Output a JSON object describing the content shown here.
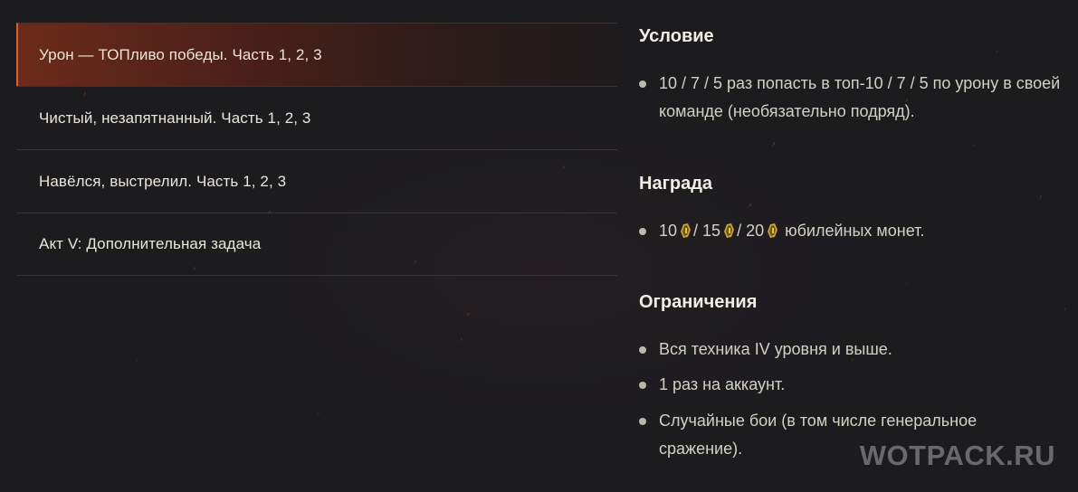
{
  "tabs": [
    {
      "label": "Урон — ТОПливо победы. Часть 1, 2, 3",
      "active": true
    },
    {
      "label": "Чистый, незапятнанный. Часть 1, 2, 3",
      "active": false
    },
    {
      "label": "Навёлся, выстрелил. Часть 1, 2, 3",
      "active": false
    },
    {
      "label": "Акт V: Дополнительная задача",
      "active": false
    }
  ],
  "condition": {
    "title": "Условие",
    "items": [
      "10 / 7 / 5 раз попасть в топ-10 / 7 / 5 по урону в своей команде (необязательно подряд)."
    ]
  },
  "reward": {
    "title": "Награда",
    "parts": [
      "10",
      "/ 15",
      "/ 20",
      "юбилейных монет."
    ],
    "coin_icon": "coin-icon"
  },
  "restrictions": {
    "title": "Ограничения",
    "items": [
      "Вся техника IV уровня и выше.",
      "1 раз на аккаунт.",
      "Случайные бои (в том числе генеральное сражение)."
    ]
  },
  "watermark": "WOTPACK.RU",
  "colors": {
    "background": "#1c1c1f",
    "active_accent": "#d8613a",
    "text": "#e6e1d3",
    "coin": "#c9a23a"
  }
}
